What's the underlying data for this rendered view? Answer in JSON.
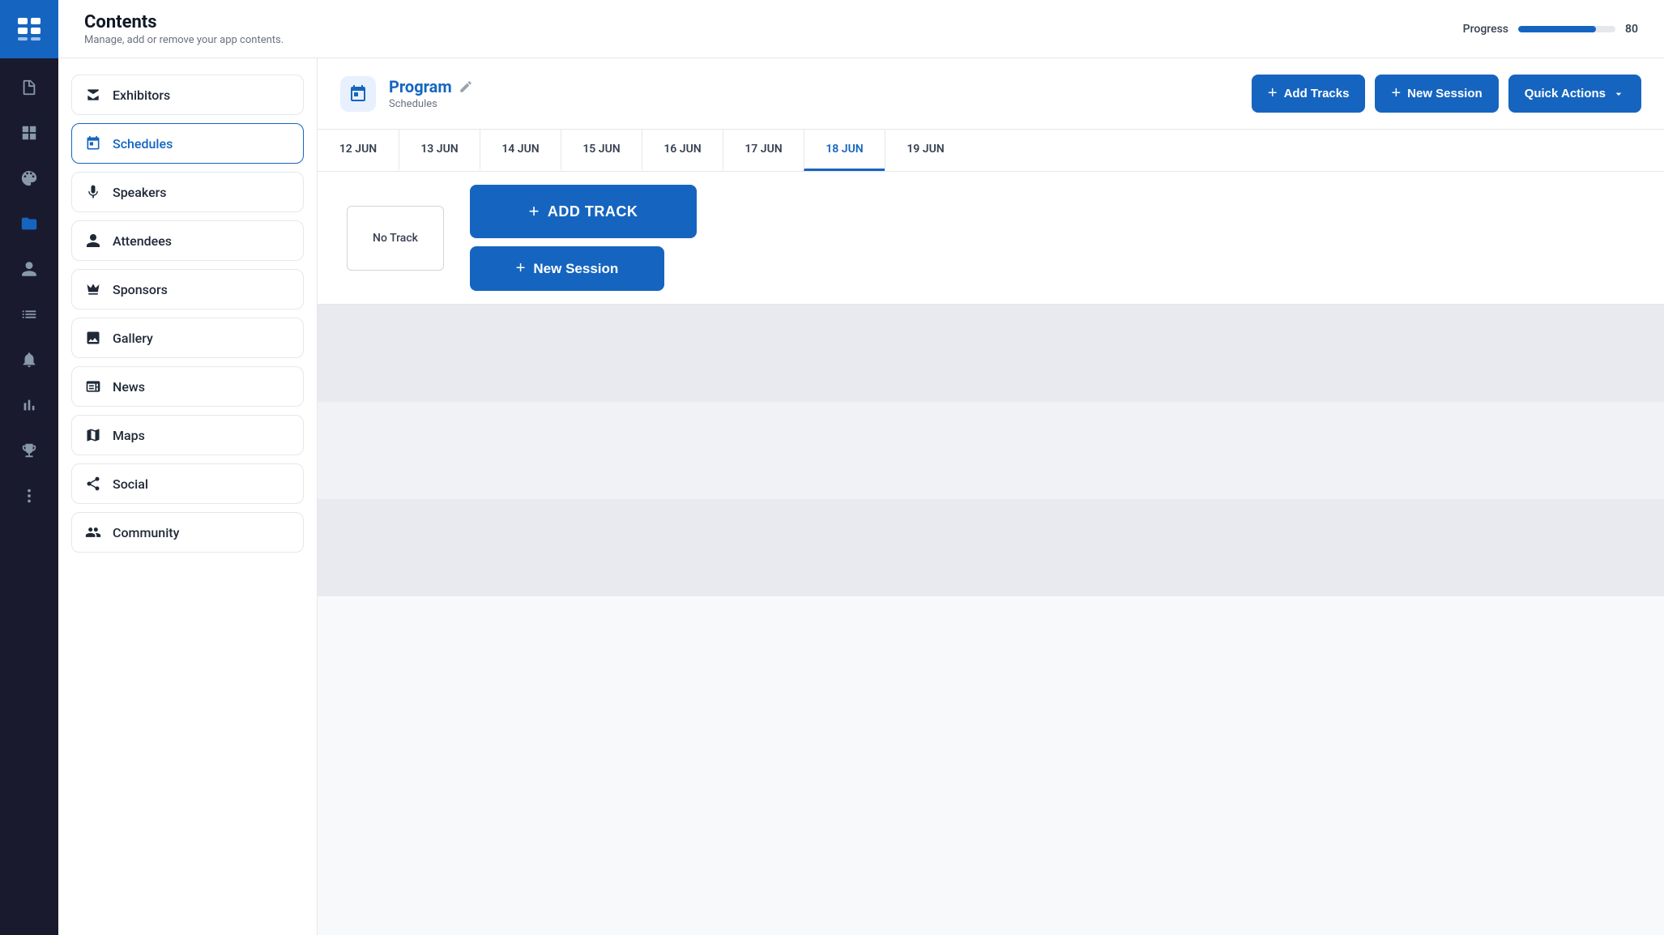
{
  "header": {
    "title": "Contents",
    "subtitle": "Manage, add or remove your app contents.",
    "progress_label": "Progress",
    "progress_value": "80",
    "progress_percent": 80
  },
  "rail_icons": [
    {
      "name": "document-icon",
      "label": "Document",
      "active": false
    },
    {
      "name": "grid-icon",
      "label": "Grid",
      "active": false
    },
    {
      "name": "palette-icon",
      "label": "Palette",
      "active": false
    },
    {
      "name": "folder-icon",
      "label": "Folder",
      "active": true
    },
    {
      "name": "person-icon",
      "label": "Person",
      "active": false
    },
    {
      "name": "list-icon",
      "label": "List",
      "active": false
    },
    {
      "name": "bell-icon",
      "label": "Bell",
      "active": false
    },
    {
      "name": "chart-icon",
      "label": "Chart",
      "active": false
    },
    {
      "name": "trophy-icon",
      "label": "Trophy",
      "active": false
    },
    {
      "name": "circle-icon",
      "label": "More",
      "active": false
    }
  ],
  "sidebar": {
    "items": [
      {
        "id": "exhibitors",
        "label": "Exhibitors",
        "icon": "store-icon",
        "active": false
      },
      {
        "id": "schedules",
        "label": "Schedules",
        "icon": "calendar-icon",
        "active": true
      },
      {
        "id": "speakers",
        "label": "Speakers",
        "icon": "mic-icon",
        "active": false
      },
      {
        "id": "attendees",
        "label": "Attendees",
        "icon": "person-icon",
        "active": false
      },
      {
        "id": "sponsors",
        "label": "Sponsors",
        "icon": "crown-icon",
        "active": false
      },
      {
        "id": "gallery",
        "label": "Gallery",
        "icon": "image-icon",
        "active": false
      },
      {
        "id": "news",
        "label": "News",
        "icon": "news-icon",
        "active": false
      },
      {
        "id": "maps",
        "label": "Maps",
        "icon": "map-icon",
        "active": false
      },
      {
        "id": "social",
        "label": "Social",
        "icon": "share-icon",
        "active": false
      },
      {
        "id": "community",
        "label": "Community",
        "icon": "community-icon",
        "active": false
      }
    ]
  },
  "program": {
    "title": "Program",
    "subtitle": "Schedules",
    "add_tracks_label": "Add Tracks",
    "new_session_label": "New Session",
    "quick_actions_label": "Quick Actions"
  },
  "date_tabs": [
    {
      "label": "12 JUN",
      "active": false
    },
    {
      "label": "13 JUN",
      "active": false
    },
    {
      "label": "14 JUN",
      "active": false
    },
    {
      "label": "15 JUN",
      "active": false
    },
    {
      "label": "16 JUN",
      "active": false
    },
    {
      "label": "17 JUN",
      "active": false
    },
    {
      "label": "18 JUN",
      "active": true
    },
    {
      "label": "19 JUN",
      "active": false
    }
  ],
  "schedule": {
    "no_track_label": "No Track",
    "add_track_label": "ADD TRACK",
    "new_session_label": "New Session"
  }
}
